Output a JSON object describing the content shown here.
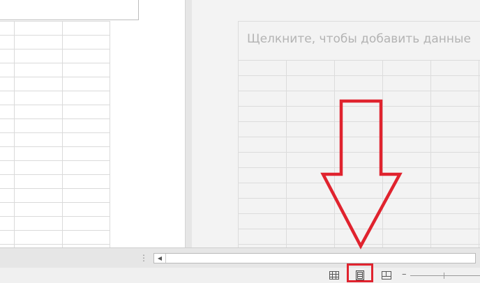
{
  "right_page": {
    "placeholder_text": "Щелкните, чтобы добавить данные"
  },
  "scrollbar": {
    "handle_glyph": "⋮",
    "left_arrow_glyph": "◀"
  },
  "status_bar": {
    "views": [
      {
        "name": "normal-view",
        "icon": "grid-icon"
      },
      {
        "name": "page-layout-view",
        "icon": "page-layout-icon",
        "selected": true
      },
      {
        "name": "page-break-preview",
        "icon": "page-break-icon"
      }
    ],
    "zoom_minus_label": "–"
  },
  "annotation": {
    "arrow_color": "#e0232e",
    "highlight_color": "#e0232e"
  }
}
